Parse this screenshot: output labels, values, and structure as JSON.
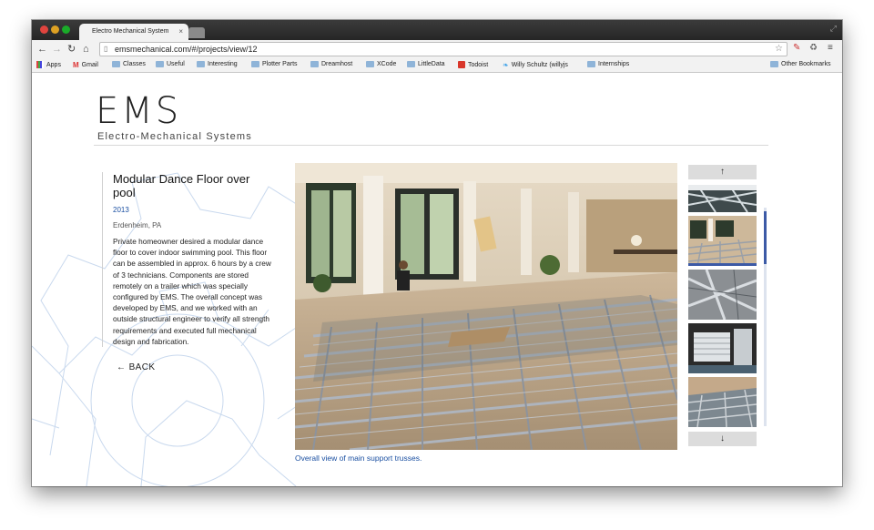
{
  "browser": {
    "tab_title": "Electro Mechanical System",
    "tab_close": "×",
    "url": "emsmechanical.com/#/projects/view/12",
    "bookmarks": [
      {
        "label": "Apps",
        "kind": "apps"
      },
      {
        "label": "Gmail",
        "kind": "gmail"
      },
      {
        "label": "Classes",
        "kind": "folder"
      },
      {
        "label": "Useful",
        "kind": "folder"
      },
      {
        "label": "Interesting",
        "kind": "folder"
      },
      {
        "label": "Plotter Parts",
        "kind": "folder"
      },
      {
        "label": "Dreamhost",
        "kind": "folder"
      },
      {
        "label": "XCode",
        "kind": "folder"
      },
      {
        "label": "LittleData",
        "kind": "folder"
      },
      {
        "label": "Todoist",
        "kind": "todoist"
      },
      {
        "label": "Willy Schultz (willyjs",
        "kind": "twitter"
      },
      {
        "label": "Internships",
        "kind": "folder"
      }
    ],
    "other_bookmarks": "Other Bookmarks"
  },
  "site": {
    "logo": "EMS",
    "tagline": "Electro-Mechanical Systems"
  },
  "project": {
    "title": "Modular Dance Floor over pool",
    "year": "2013",
    "location": "Erdenheim, PA",
    "description": "Private homeowner desired a modular dance floor to cover indoor swimming pool. This floor can be assembled in approx. 6 hours by a crew of 3 technicians. Components are stored remotely on a trailer which was specially configured by EMS. The overall concept was developed by EMS, and we worked with an outside structural engineer to verify all strength requirements and executed full mechanical design and fabrication.",
    "back_label": "← BACK",
    "caption": "Overall view of main support trusses."
  },
  "gallery": {
    "up_arrow": "↑",
    "down_arrow": "↓",
    "thumbnail_count": 5,
    "selected_index": 1
  }
}
